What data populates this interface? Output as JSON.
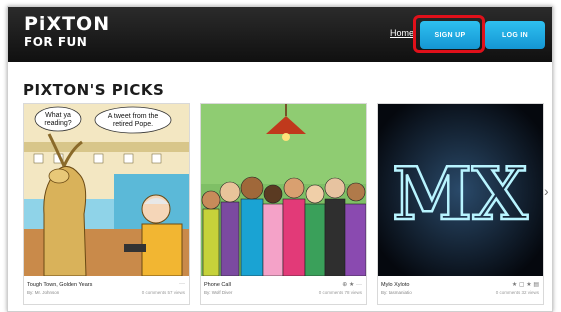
{
  "header": {
    "logo_brand": "PiXTON",
    "logo_sub": "FOR FUN",
    "home_label": "Home",
    "signup_label": "SIGN UP",
    "login_label": "LOG IN"
  },
  "section_title": "PIXTON'S PICKS",
  "cards": [
    {
      "title": "Tough Town, Golden Years",
      "by": "By: Mr. Johnson",
      "stats": "0 comments  57 views",
      "bubble1": [
        "What ya",
        "reading?"
      ],
      "bubble2": [
        "A tweet from the",
        "retired Pope."
      ]
    },
    {
      "title": "Phone Call",
      "by": "By: Wolf Diver",
      "stats": "0 comments  78 views"
    },
    {
      "title": "Mylo Xyloto",
      "by": "By: tasmaniatio",
      "stats": "0 comments  32 views",
      "art_text": "MX"
    }
  ],
  "colors": {
    "header_bg": "#141414",
    "button_blue": "#1ea7e1",
    "highlight_red": "#e0101a"
  }
}
